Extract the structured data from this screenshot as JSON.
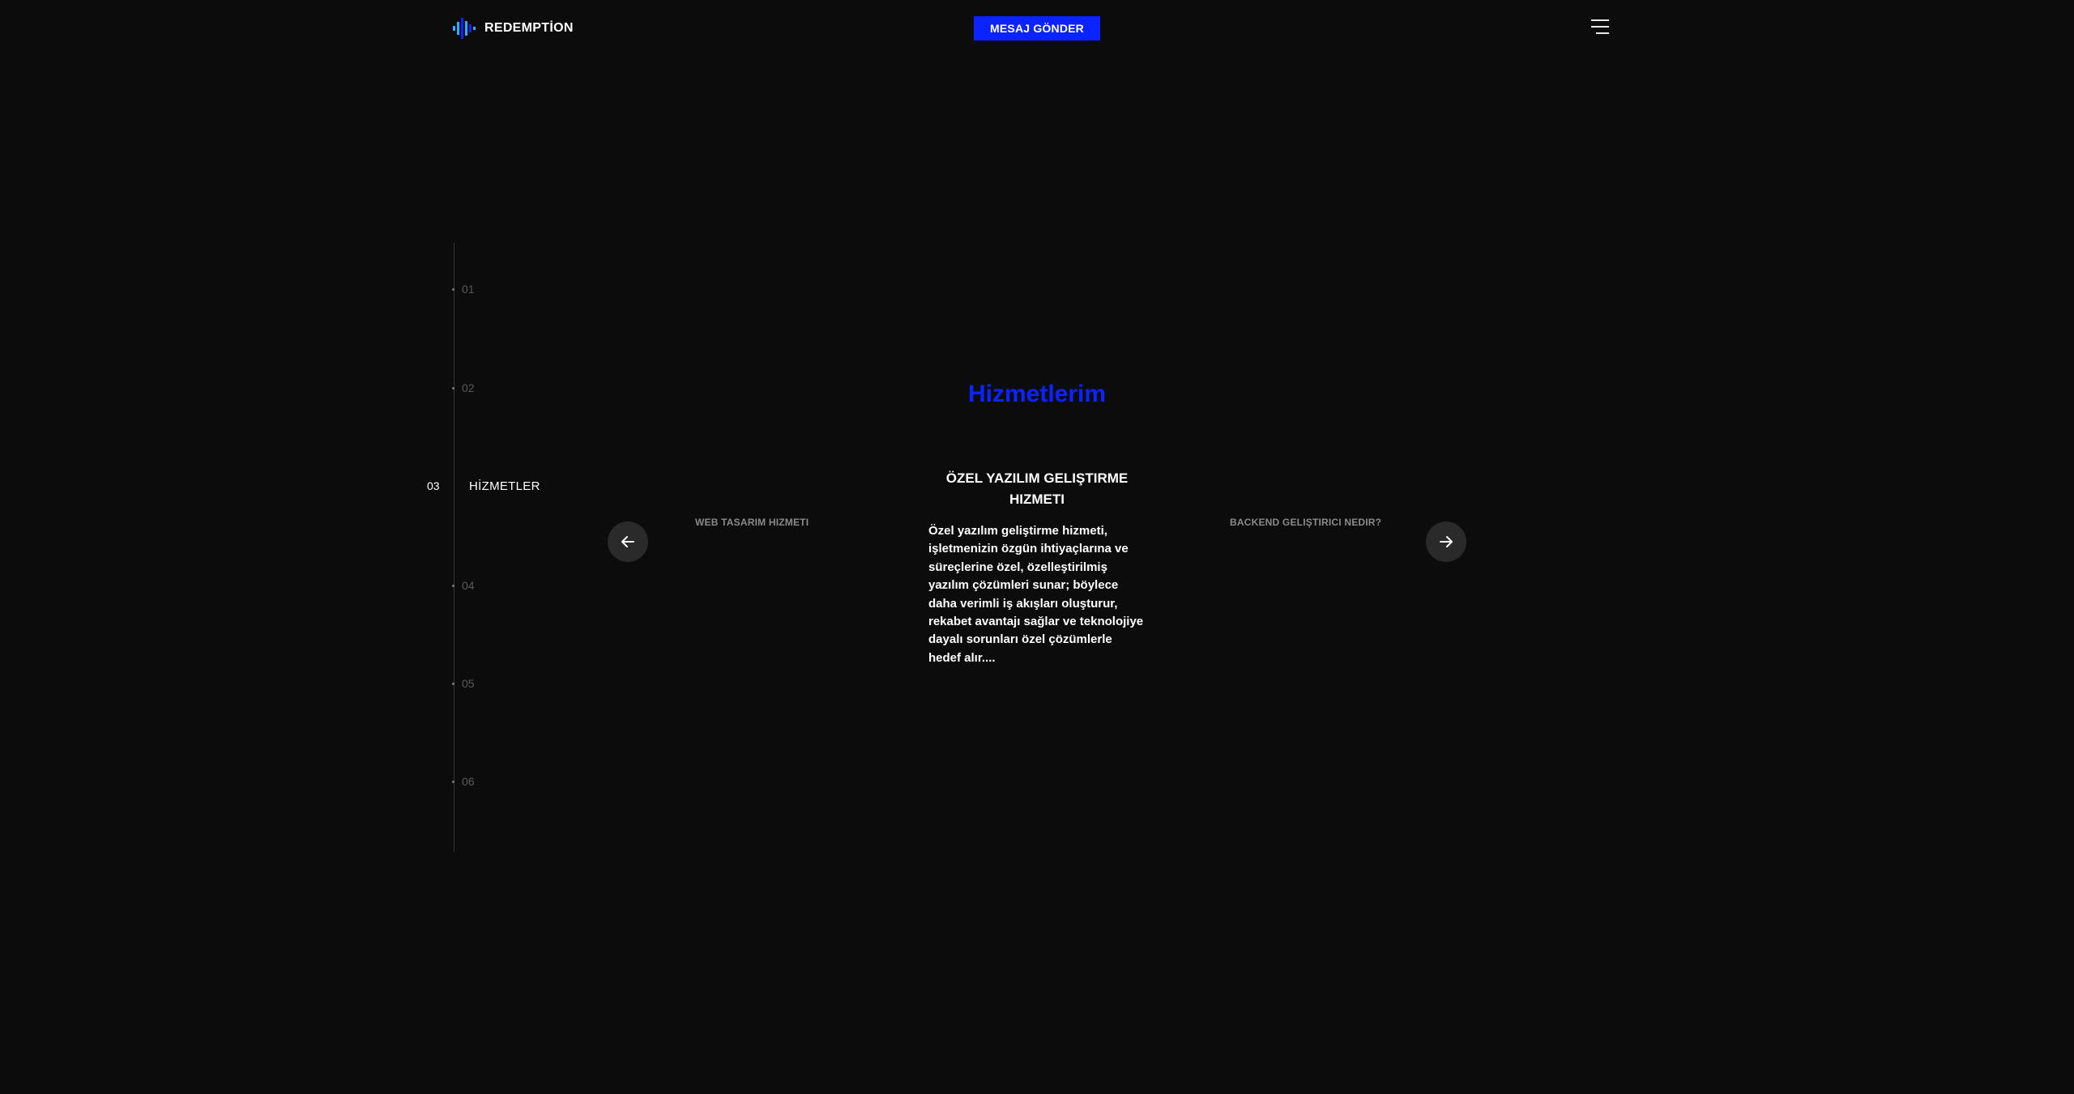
{
  "header": {
    "brand": "REDEMPTİON",
    "cta_label": "MESAJ GÖNDER",
    "brand_colors": [
      "#1fb4ff",
      "#0b24ff"
    ]
  },
  "timeline": {
    "items": [
      {
        "number": "01"
      },
      {
        "number": "02"
      },
      {
        "number": "03",
        "label": "HİZMETLER",
        "active": true
      },
      {
        "number": "04"
      },
      {
        "number": "05"
      },
      {
        "number": "06"
      }
    ]
  },
  "services": {
    "title": "Hizmetlerim",
    "current_title": "ÖZEL YAZILIM GELIŞTIRME HIZMETI",
    "current_description": "Özel yazılım geliştirme hizmeti, işletmenizin özgün ihtiyaçlarına ve süreçlerine özel, özelleştirilmiş yazılım çözümleri sunar; böylece daha verimli iş akışları oluşturur, rekabet avantajı sağlar ve teknolojiye dayalı sorunları özel çözümlerle hedef alır....",
    "prev_label": "WEB TASARIM HIZMETI",
    "next_label": "BACKEND GELIŞTIRICI NEDIR?",
    "accent_color": "#0b24ff"
  }
}
